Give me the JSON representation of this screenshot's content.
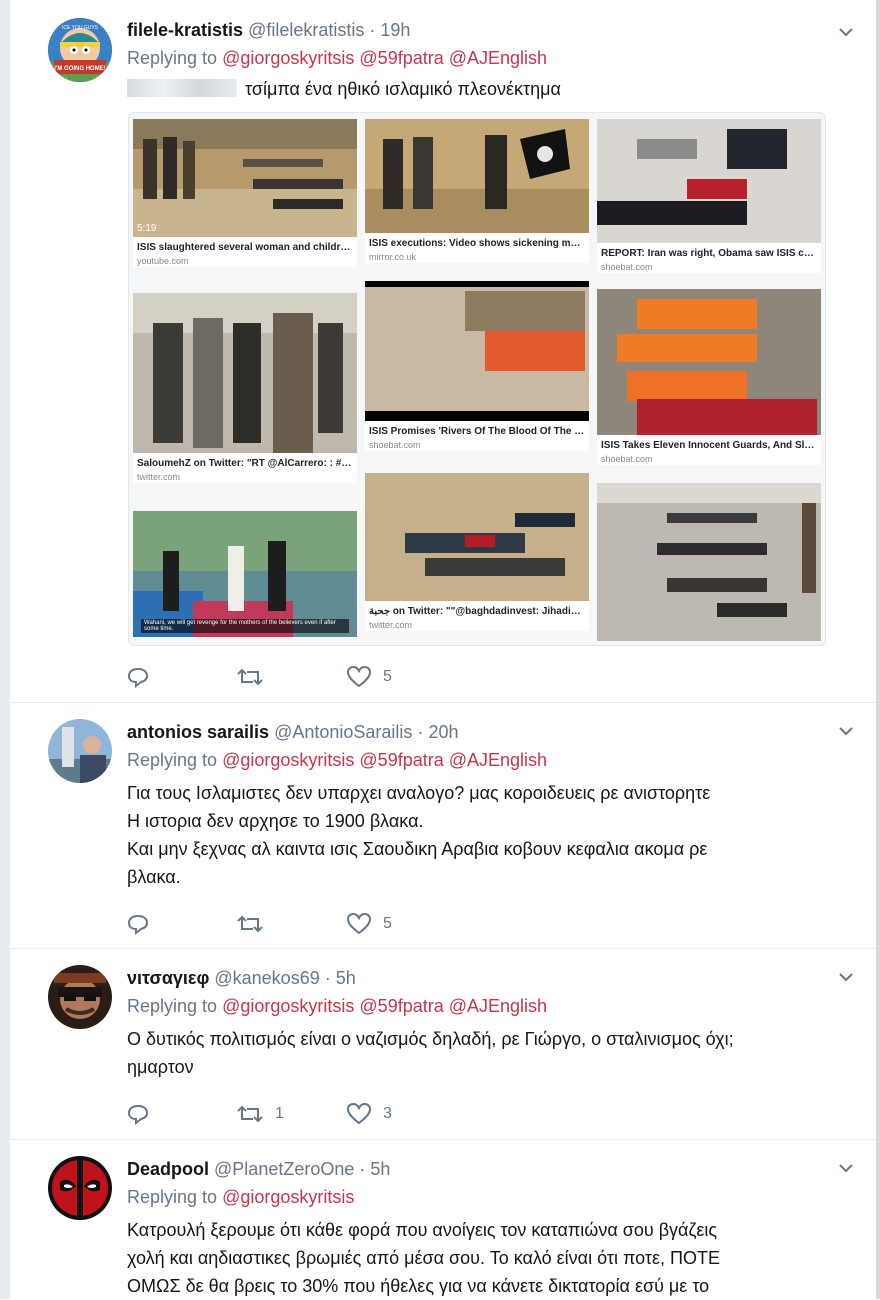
{
  "tweets": [
    {
      "name": "filele-kratistis",
      "handle": "@filelekratistis",
      "time": "19h",
      "replying_label": "Replying to",
      "mentions": [
        "@giorgoskyritsis",
        "@59fpatra",
        "@AJEnglish"
      ],
      "text": "τσίμπα ένα ηθικό ισλαμικό πλεονέκτημα",
      "replies": "",
      "retweets": "",
      "likes": "5",
      "images": [
        {
          "caption": "ISIS slaughtered several woman and children...",
          "source": "youtube.com",
          "duration": "5:19"
        },
        {
          "caption": "SaloumehZ on Twitter: \"RT @AlCarrero: : #IS...",
          "source": "twitter.com"
        },
        {
          "caption": "",
          "source": "",
          "subtitle": "Wahani, we will get revenge for the mothers of the believers even if after some time."
        },
        {
          "caption": "ISIS executions: Video shows sickening mas...",
          "source": "mirror.co.uk"
        },
        {
          "caption": "ISIS Promises 'Rivers Of The Blood Of The C...",
          "source": "shoebat.com"
        },
        {
          "caption": "جحبة on Twitter: \"\"@baghdadinvest: Jihadist f...",
          "source": "twitter.com"
        },
        {
          "caption": "REPORT: Iran was right, Obama saw ISIS co...",
          "source": "shoebat.com"
        },
        {
          "caption": "ISIS Takes Eleven Innocent Guards, And Slau...",
          "source": "shoebat.com"
        },
        {
          "caption": "",
          "source": ""
        }
      ]
    },
    {
      "name": "antonios sarailis",
      "handle": "@AntonioSarailis",
      "time": "20h",
      "replying_label": "Replying to",
      "mentions": [
        "@giorgoskyritsis",
        "@59fpatra",
        "@AJEnglish"
      ],
      "text_lines": [
        "Για τους Ισλαμιστες δεν υπαρχει αναλογο? μας κοροιδευεις ρε ανιστορητε",
        "Η ιστορια δεν αρχησε το 1900 βλακα.",
        "Και μην ξεχνας αλ καιντα ισις Σαουδικη Αραβια κοβουν κεφαλια ακομα ρε",
        "βλακα."
      ],
      "replies": "",
      "retweets": "",
      "likes": "5"
    },
    {
      "name": "νιτσαγιεφ",
      "handle": "@kanekos69",
      "time": "5h",
      "replying_label": "Replying to",
      "mentions": [
        "@giorgoskyritsis",
        "@59fpatra",
        "@AJEnglish"
      ],
      "text_lines": [
        "Ο δυτικός πολιτισμός είναι ο ναζισμός δηλαδή, ρε Γιώργο, ο σταλινισμος όχι;",
        "ημαρτον"
      ],
      "replies": "",
      "retweets": "1",
      "likes": "3"
    },
    {
      "name": "Deadpool",
      "handle": "@PlanetZeroOne",
      "time": "5h",
      "replying_label": "Replying to",
      "mentions": [
        "@giorgoskyritsis"
      ],
      "text_lines": [
        "Κατρουλή ξερουμε ότι κάθε φορά που ανοίγεις τον καταπιώνα σου βγάζεις",
        "χολή και αηδιαστικες βρωμιές από μέσα σου. Το καλό είναι ότι ποτε, ΠΟΤΕ",
        "ΟΜΩΣ δε θα βρεις το 30% που ήθελες για να κάνετε δικτατορία εσύ με το"
      ]
    }
  ],
  "avatar_text": {
    "top": "ICE YOU GUYS",
    "bottom": "I'M GOING HOME!"
  },
  "colors": {
    "mention": "#c5364a",
    "secondary": "#657786",
    "text": "#14171a",
    "divider": "#e6ecf0"
  }
}
